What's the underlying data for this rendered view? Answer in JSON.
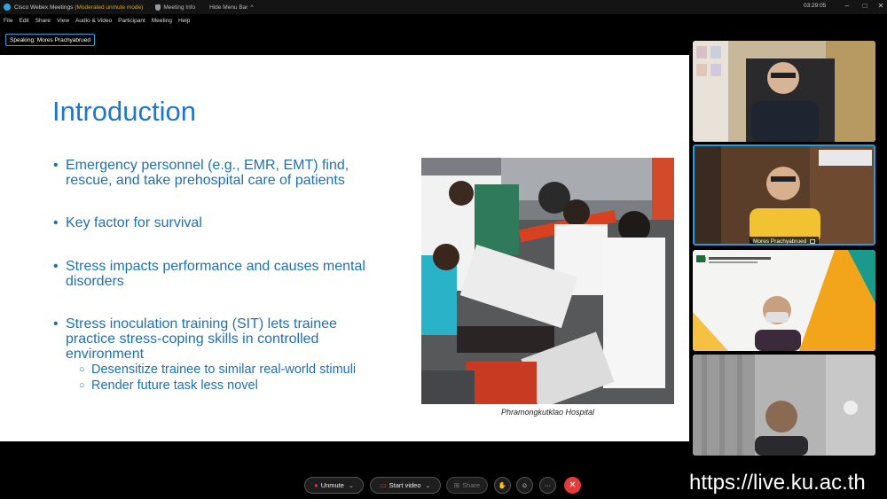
{
  "titlebar": {
    "app_title": "Cisco Webex Meetings",
    "mode": "(Moderated unmute mode)",
    "meeting_info": "Meeting Info",
    "hide_menu": "Hide Menu Bar",
    "hide_menu_chevron": "^",
    "time": "03:29:05",
    "minimize": "–",
    "maximize": "□",
    "close": "✕"
  },
  "menu": {
    "items": [
      "File",
      "Edit",
      "Share",
      "View",
      "Audio & Video",
      "Participant",
      "Meeting",
      "Help"
    ]
  },
  "speaking": {
    "label": "Speaking: Mores Prachyabrued"
  },
  "slide": {
    "title": "Introduction",
    "bullets": [
      {
        "lines": [
          "Emergency personnel (e.g., EMR, EMT) find,",
          "rescue, and take prehospital care of patients"
        ]
      },
      {
        "lines": [
          "Key factor for survival"
        ]
      },
      {
        "lines": [
          "Stress impacts performance and causes mental",
          "disorders"
        ]
      },
      {
        "lines": [
          "Stress inoculation training (SIT) lets trainee",
          "practice stress-coping skills in controlled",
          "environment"
        ]
      }
    ],
    "subbullets": [
      "Desensitize trainee to similar real-world stimuli",
      "Render future task less novel"
    ],
    "photo_caption": "Phramongkutklao Hospital"
  },
  "participants": {
    "tile2_name": "Mores Prachyabrued",
    "tile3_logo": "KU"
  },
  "controls": {
    "unmute": "Unmute",
    "start_video": "Start video",
    "share": "Share",
    "more": "···",
    "end": "✕"
  },
  "watermark": "https://live.ku.ac.th",
  "colors": {
    "accent": "#1a9ee8",
    "slide_text": "#1f6fb5",
    "end_button": "#e33b3b"
  }
}
